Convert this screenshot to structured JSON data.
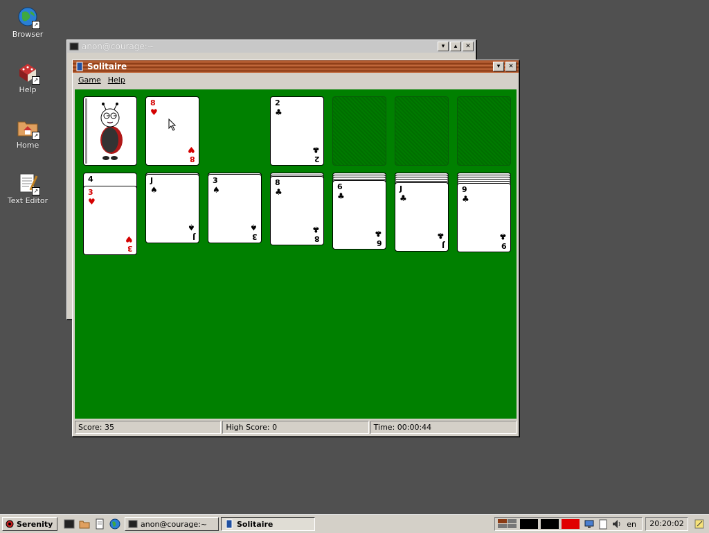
{
  "desktop": {
    "icons": [
      {
        "label": "Browser"
      },
      {
        "label": "Help"
      },
      {
        "label": "Home"
      },
      {
        "label": "Text Editor"
      }
    ]
  },
  "terminal_window": {
    "title": "anon@courage:~"
  },
  "solitaire": {
    "title": "Solitaire",
    "menu": [
      "Game",
      "Help"
    ],
    "waste": {
      "rank": "8",
      "suit": "♥",
      "color": "red"
    },
    "foundations": [
      {
        "rank": "2",
        "suit": "♣",
        "color": "black"
      }
    ],
    "tableau": [
      {
        "hidden_rank": "4",
        "rank": "3",
        "suit": "♥",
        "color": "red"
      },
      {
        "rank": "J",
        "suit": "♠",
        "color": "black"
      },
      {
        "rank": "3",
        "suit": "♠",
        "color": "black"
      },
      {
        "rank": "8",
        "suit": "♣",
        "color": "black"
      },
      {
        "rank": "6",
        "suit": "♣",
        "color": "black"
      },
      {
        "rank": "J",
        "suit": "♣",
        "color": "black"
      },
      {
        "rank": "9",
        "suit": "♣",
        "color": "black"
      }
    ],
    "status": {
      "score": "Score: 35",
      "high_score": "High Score: 0",
      "time": "Time: 00:00:44"
    },
    "felt_color": "#008000"
  },
  "taskbar": {
    "start_label": "Serenity",
    "tasks": [
      {
        "label": "anon@courage:~",
        "active": false
      },
      {
        "label": "Solitaire",
        "active": true
      }
    ],
    "keyboard_layout": "en",
    "clock": "20:20:02"
  }
}
